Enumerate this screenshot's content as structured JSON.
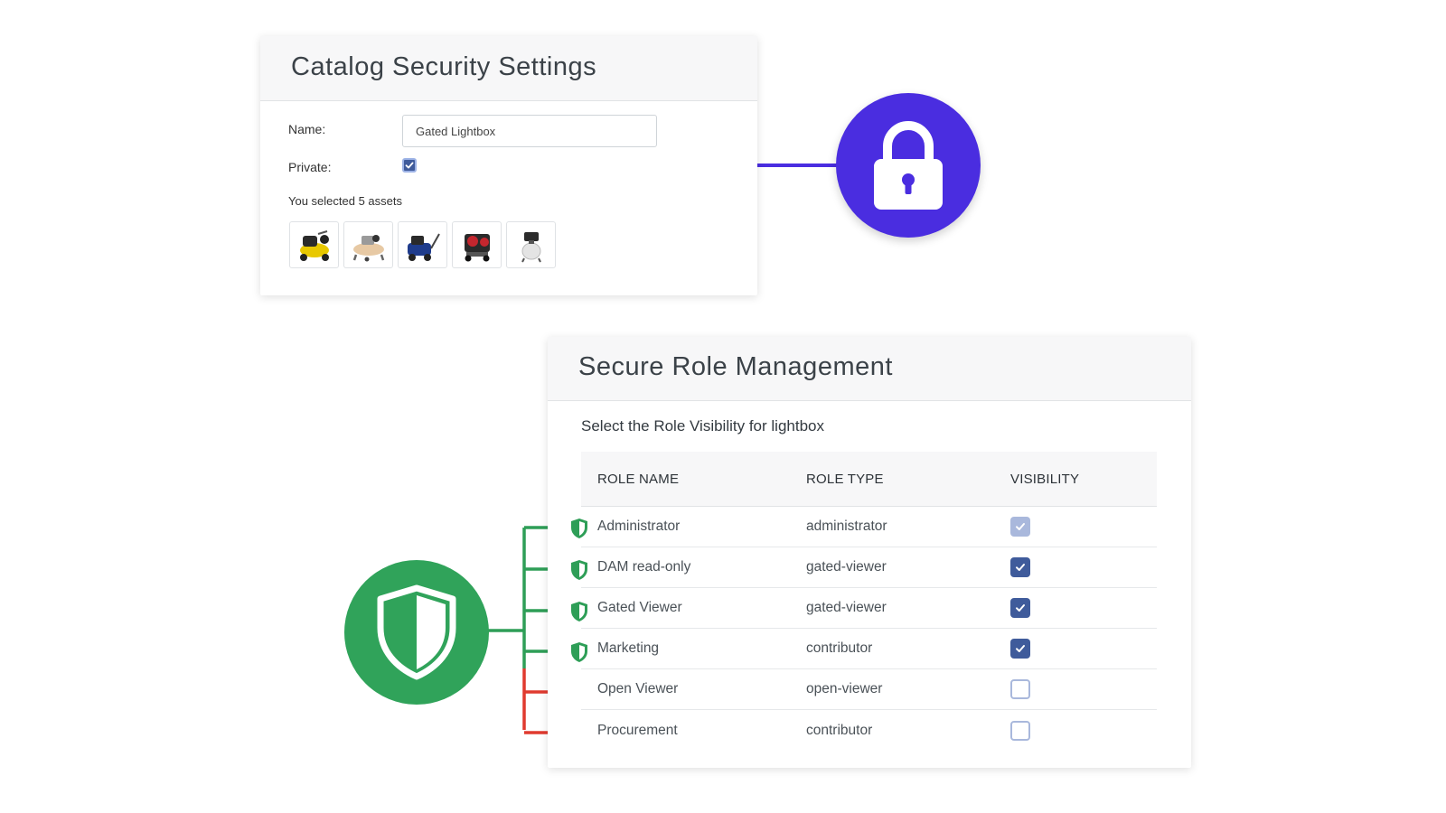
{
  "catalog": {
    "title": "Catalog Security Settings",
    "name_label": "Name:",
    "name_value": "Gated Lightbox",
    "private_label": "Private:",
    "private_checked": true,
    "selected_text": "You selected 5 assets",
    "assets": [
      {
        "icon": "yellow-air-compressor-icon"
      },
      {
        "icon": "beige-air-compressor-icon"
      },
      {
        "icon": "blue-air-compressor-icon"
      },
      {
        "icon": "red-air-compressor-icon"
      },
      {
        "icon": "white-air-compressor-icon"
      }
    ]
  },
  "lock_badge": {
    "icon": "lock-icon",
    "color": "#4a2de0"
  },
  "roles": {
    "title": "Secure Role Management",
    "subtitle": "Select the Role Visibility for lightbox",
    "headers": {
      "name": "ROLE NAME",
      "type": "ROLE TYPE",
      "visibility": "VISIBILITY"
    },
    "rows": [
      {
        "name": "Administrator",
        "type": "administrator",
        "visibility": "checked-disabled",
        "shielded": true
      },
      {
        "name": "DAM read-only",
        "type": "gated-viewer",
        "visibility": "checked",
        "shielded": true
      },
      {
        "name": "Gated Viewer",
        "type": "gated-viewer",
        "visibility": "checked",
        "shielded": true
      },
      {
        "name": "Marketing",
        "type": "contributor",
        "visibility": "checked",
        "shielded": true
      },
      {
        "name": "Open Viewer",
        "type": "open-viewer",
        "visibility": "unchecked",
        "shielded": false
      },
      {
        "name": "Procurement",
        "type": "contributor",
        "visibility": "unchecked",
        "shielded": false
      }
    ]
  },
  "shield_badge": {
    "icon": "shield-icon",
    "color": "#30a35a"
  },
  "colors": {
    "lock_arrow": "#4a2de0",
    "allowed_arrow": "#2e9e57",
    "denied_arrow": "#e03a2f",
    "checkbox_on": "#3f5b9b"
  }
}
